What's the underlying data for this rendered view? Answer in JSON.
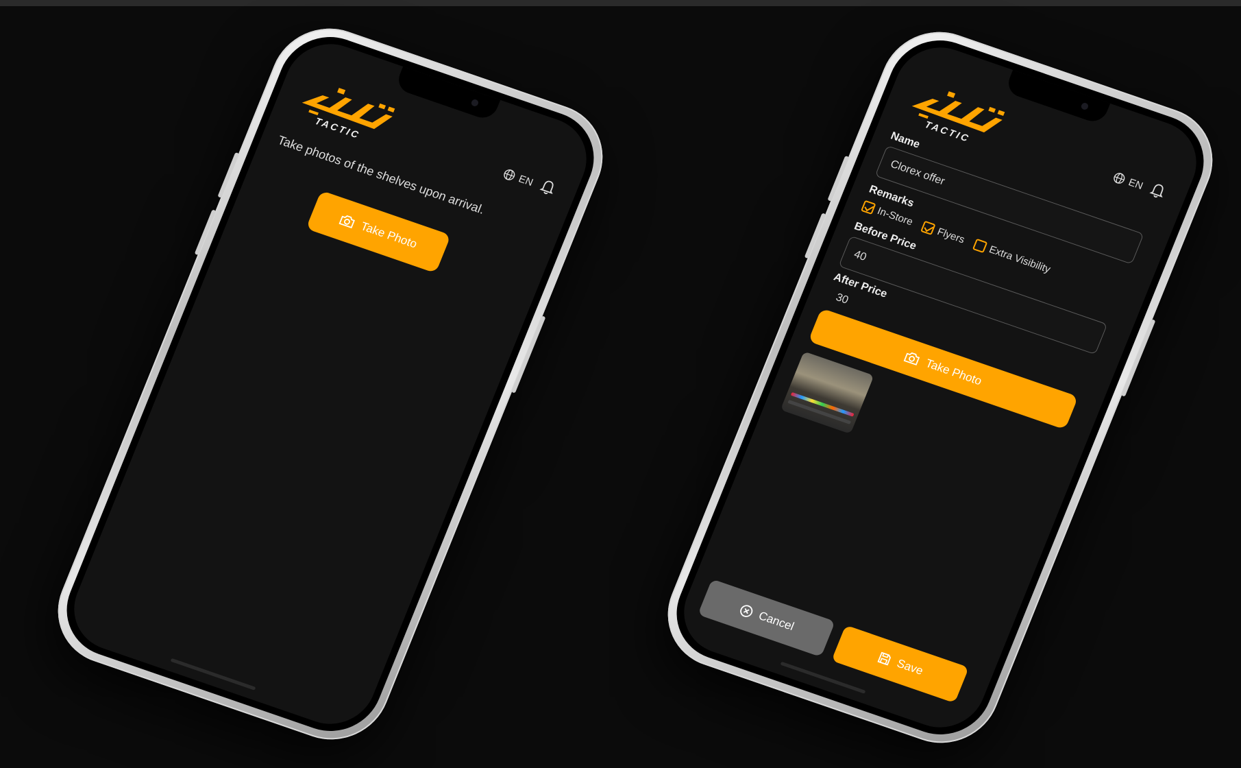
{
  "brand": {
    "logo_text": "TACTIC",
    "accent_color": "#ffa400"
  },
  "header": {
    "language": "EN",
    "language_icon": "globe-icon",
    "notification_icon": "bell-icon"
  },
  "screen_one": {
    "instruction": "Take photos of the shelves upon arrival.",
    "take_photo_label": "Take Photo"
  },
  "screen_two": {
    "name_label": "Name",
    "name_value": "Clorex offer",
    "remarks_label": "Remarks",
    "remarks": [
      {
        "label": "In-Store",
        "checked": true
      },
      {
        "label": "Flyers",
        "checked": true
      },
      {
        "label": "Extra Visibility",
        "checked": false
      }
    ],
    "before_price_label": "Before Price",
    "before_price_value": "40",
    "after_price_label": "After Price",
    "after_price_value": "30",
    "take_photo_label": "Take Photo",
    "cancel_label": "Cancel",
    "save_label": "Save"
  }
}
